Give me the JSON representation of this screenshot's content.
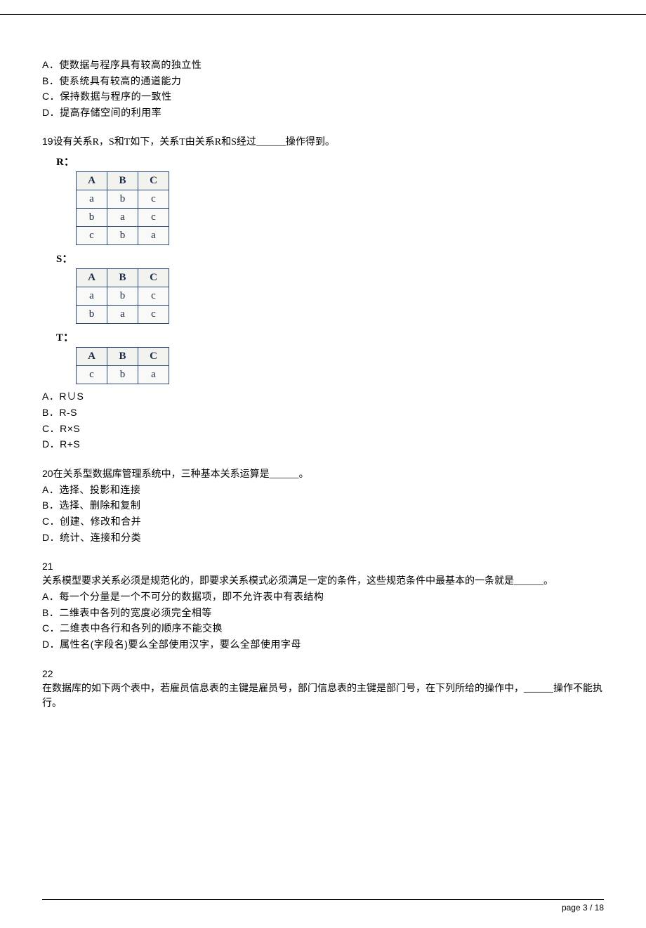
{
  "q18_tail_options": [
    "A．使数据与程序具有较高的独立性",
    "B．使系统具有较高的通道能力",
    "C．保持数据与程序的一致性",
    "D．提高存储空间的利用率"
  ],
  "q19": {
    "num": "19",
    "stem": "设有关系R，S和T如下，关系T由关系R和S经过______操作得到。",
    "relations": {
      "R": {
        "label": "R：",
        "headers": [
          "A",
          "B",
          "C"
        ],
        "rows": [
          [
            "a",
            "b",
            "c"
          ],
          [
            "b",
            "a",
            "c"
          ],
          [
            "c",
            "b",
            "a"
          ]
        ]
      },
      "S": {
        "label": "S：",
        "headers": [
          "A",
          "B",
          "C"
        ],
        "rows": [
          [
            "a",
            "b",
            "c"
          ],
          [
            "b",
            "a",
            "c"
          ]
        ]
      },
      "T": {
        "label": "T：",
        "headers": [
          "A",
          "B",
          "C"
        ],
        "rows": [
          [
            "c",
            "b",
            "a"
          ]
        ]
      }
    },
    "options": [
      "A．R∪S",
      "B．R-S",
      "C．R×S",
      "D．R+S"
    ]
  },
  "q20": {
    "num": "20",
    "stem": "在关系型数据库管理系统中，三种基本关系运算是______。",
    "options": [
      "A．选择、投影和连接",
      "B．选择、删除和复制",
      "C．创建、修改和合并",
      "D．统计、连接和分类"
    ]
  },
  "q21": {
    "num": "21",
    "stem": "关系模型要求关系必须是规范化的，即要求关系模式必须满足一定的条件，这些规范条件中最基本的一条就是______。",
    "options": [
      "A．每一个分量是一个不可分的数据项，即不允许表中有表结构",
      "B．二维表中各列的宽度必须完全相等",
      "C．二维表中各行和各列的顺序不能交换",
      "D．属性名(字段名)要么全部使用汉字，要么全部使用字母"
    ]
  },
  "q22": {
    "num": "22",
    "stem": "在数据库的如下两个表中，若雇员信息表的主键是雇员号，部门信息表的主键是部门号，在下列所给的操作中，______操作不能执行。"
  },
  "footer": "page 3 / 18"
}
